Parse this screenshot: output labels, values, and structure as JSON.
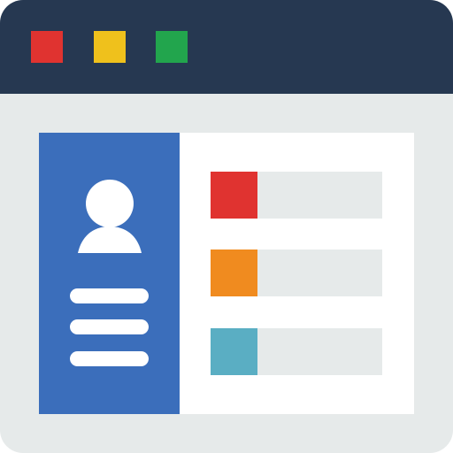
{
  "colors": {
    "titlebar": "#263851",
    "window_body": "#E6EAEA",
    "content_bg": "#FFFFFF",
    "profile_panel": "#3B6EBB",
    "bar_track": "#E6EAEA"
  },
  "window_controls": [
    {
      "icon": "close-square-icon",
      "color": "#E03330"
    },
    {
      "icon": "minimize-square-icon",
      "color": "#EFC11C"
    },
    {
      "icon": "maximize-square-icon",
      "color": "#22A54D"
    }
  ],
  "profile": {
    "avatar_icon": "user-avatar-icon",
    "text_lines": 3
  },
  "list_items": [
    {
      "swatch_color": "#E03330"
    },
    {
      "swatch_color": "#F08B1F"
    },
    {
      "swatch_color": "#5AAEC3"
    }
  ]
}
